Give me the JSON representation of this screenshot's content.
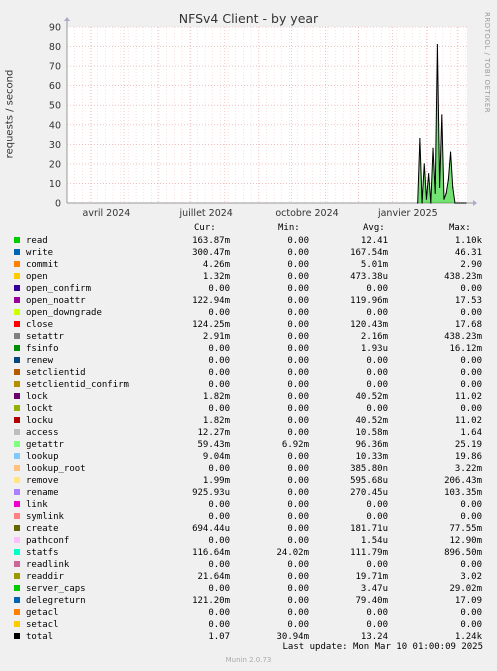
{
  "title": "NFSv4 Client - by year",
  "ylabel": "requests / second",
  "side_credit": "RRDTOOL / TOBI OETIKER",
  "legend_header": {
    "cur": "Cur:",
    "min": "Min:",
    "avg": "Avg:",
    "max": "Max:"
  },
  "chart_data": {
    "type": "area",
    "title": "NFSv4 Client - by year",
    "ylabel": "requests / second",
    "ylim": [
      0,
      90
    ],
    "yticks": [
      0,
      10,
      20,
      30,
      40,
      50,
      60,
      70,
      80,
      90
    ],
    "xtick_labels": [
      "avril 2024",
      "juillet 2024",
      "octobre 2024",
      "janvier 2025"
    ],
    "grid": true,
    "series": [
      {
        "name": "total",
        "x": [
          "2025-01-24",
          "2025-01-26",
          "2025-01-28",
          "2025-01-30",
          "2025-02-01",
          "2025-02-03",
          "2025-02-05",
          "2025-02-07",
          "2025-02-09",
          "2025-02-11",
          "2025-02-13",
          "2025-02-15",
          "2025-02-17",
          "2025-02-19",
          "2025-02-21",
          "2025-02-23",
          "2025-02-25",
          "2025-02-27",
          "2025-03-01",
          "2025-03-03",
          "2025-03-05",
          "2025-03-07",
          "2025-03-09"
        ],
        "values": [
          0,
          33,
          0,
          20,
          2,
          15,
          0,
          28,
          5,
          81,
          8,
          45,
          2,
          5,
          12,
          26,
          8,
          0,
          0,
          0,
          0,
          0,
          0
        ]
      }
    ]
  },
  "legend": [
    {
      "name": "read",
      "color": "#00cc00",
      "cur": "163.87m",
      "min": "0.00",
      "avg": "12.41",
      "max": "1.10k"
    },
    {
      "name": "write",
      "color": "#0066b3",
      "cur": "300.47m",
      "min": "0.00",
      "avg": "167.54m",
      "max": "46.31"
    },
    {
      "name": "commit",
      "color": "#ff8000",
      "cur": "4.26m",
      "min": "0.00",
      "avg": "5.01m",
      "max": "2.90"
    },
    {
      "name": "open",
      "color": "#ffcc00",
      "cur": "1.32m",
      "min": "0.00",
      "avg": "473.38u",
      "max": "438.23m"
    },
    {
      "name": "open_confirm",
      "color": "#330099",
      "cur": "0.00",
      "min": "0.00",
      "avg": "0.00",
      "max": "0.00"
    },
    {
      "name": "open_noattr",
      "color": "#990099",
      "cur": "122.94m",
      "min": "0.00",
      "avg": "119.96m",
      "max": "17.53"
    },
    {
      "name": "open_downgrade",
      "color": "#ccff00",
      "cur": "0.00",
      "min": "0.00",
      "avg": "0.00",
      "max": "0.00"
    },
    {
      "name": "close",
      "color": "#ff0000",
      "cur": "124.25m",
      "min": "0.00",
      "avg": "120.43m",
      "max": "17.68"
    },
    {
      "name": "setattr",
      "color": "#808080",
      "cur": "2.91m",
      "min": "0.00",
      "avg": "2.16m",
      "max": "438.23m"
    },
    {
      "name": "fsinfo",
      "color": "#008f00",
      "cur": "0.00",
      "min": "0.00",
      "avg": "1.93u",
      "max": "16.12m"
    },
    {
      "name": "renew",
      "color": "#00487d",
      "cur": "0.00",
      "min": "0.00",
      "avg": "0.00",
      "max": "0.00"
    },
    {
      "name": "setclientid",
      "color": "#b35a00",
      "cur": "0.00",
      "min": "0.00",
      "avg": "0.00",
      "max": "0.00"
    },
    {
      "name": "setclientid_confirm",
      "color": "#b38f00",
      "cur": "0.00",
      "min": "0.00",
      "avg": "0.00",
      "max": "0.00"
    },
    {
      "name": "lock",
      "color": "#6b006b",
      "cur": "1.82m",
      "min": "0.00",
      "avg": "40.52m",
      "max": "11.02"
    },
    {
      "name": "lockt",
      "color": "#8fb300",
      "cur": "0.00",
      "min": "0.00",
      "avg": "0.00",
      "max": "0.00"
    },
    {
      "name": "locku",
      "color": "#b30000",
      "cur": "1.82m",
      "min": "0.00",
      "avg": "40.52m",
      "max": "11.02"
    },
    {
      "name": "access",
      "color": "#bebebe",
      "cur": "12.27m",
      "min": "0.00",
      "avg": "10.58m",
      "max": "1.64"
    },
    {
      "name": "getattr",
      "color": "#80ff80",
      "cur": "59.43m",
      "min": "6.92m",
      "avg": "96.36m",
      "max": "25.19"
    },
    {
      "name": "lookup",
      "color": "#80c9ff",
      "cur": "9.04m",
      "min": "0.00",
      "avg": "10.33m",
      "max": "19.86"
    },
    {
      "name": "lookup_root",
      "color": "#ffc080",
      "cur": "0.00",
      "min": "0.00",
      "avg": "385.80n",
      "max": "3.22m"
    },
    {
      "name": "remove",
      "color": "#ffe680",
      "cur": "1.99m",
      "min": "0.00",
      "avg": "595.68u",
      "max": "206.43m"
    },
    {
      "name": "rename",
      "color": "#aa80ff",
      "cur": "925.93u",
      "min": "0.00",
      "avg": "270.45u",
      "max": "103.35m"
    },
    {
      "name": "link",
      "color": "#ee00cc",
      "cur": "0.00",
      "min": "0.00",
      "avg": "0.00",
      "max": "0.00"
    },
    {
      "name": "symlink",
      "color": "#ff8080",
      "cur": "0.00",
      "min": "0.00",
      "avg": "0.00",
      "max": "0.00"
    },
    {
      "name": "create",
      "color": "#666600",
      "cur": "694.44u",
      "min": "0.00",
      "avg": "181.71u",
      "max": "77.55m"
    },
    {
      "name": "pathconf",
      "color": "#ffbfff",
      "cur": "0.00",
      "min": "0.00",
      "avg": "1.54u",
      "max": "12.90m"
    },
    {
      "name": "statfs",
      "color": "#00ffcc",
      "cur": "116.64m",
      "min": "24.02m",
      "avg": "111.79m",
      "max": "896.50m"
    },
    {
      "name": "readlink",
      "color": "#cc6699",
      "cur": "0.00",
      "min": "0.00",
      "avg": "0.00",
      "max": "0.00"
    },
    {
      "name": "readdir",
      "color": "#999900",
      "cur": "21.64m",
      "min": "0.00",
      "avg": "19.71m",
      "max": "3.02"
    },
    {
      "name": "server_caps",
      "color": "#00cc00",
      "cur": "0.00",
      "min": "0.00",
      "avg": "3.47u",
      "max": "29.02m"
    },
    {
      "name": "delegreturn",
      "color": "#0066b3",
      "cur": "121.20m",
      "min": "0.00",
      "avg": "79.40m",
      "max": "17.09"
    },
    {
      "name": "getacl",
      "color": "#ff8000",
      "cur": "0.00",
      "min": "0.00",
      "avg": "0.00",
      "max": "0.00"
    },
    {
      "name": "setacl",
      "color": "#ffcc00",
      "cur": "0.00",
      "min": "0.00",
      "avg": "0.00",
      "max": "0.00"
    },
    {
      "name": "total",
      "color": "#000000",
      "cur": "1.07",
      "min": "30.94m",
      "avg": "13.24",
      "max": "1.24k"
    }
  ],
  "last_update": "Last update: Mon Mar 10 01:00:09 2025",
  "footer": "Munin 2.0.73"
}
